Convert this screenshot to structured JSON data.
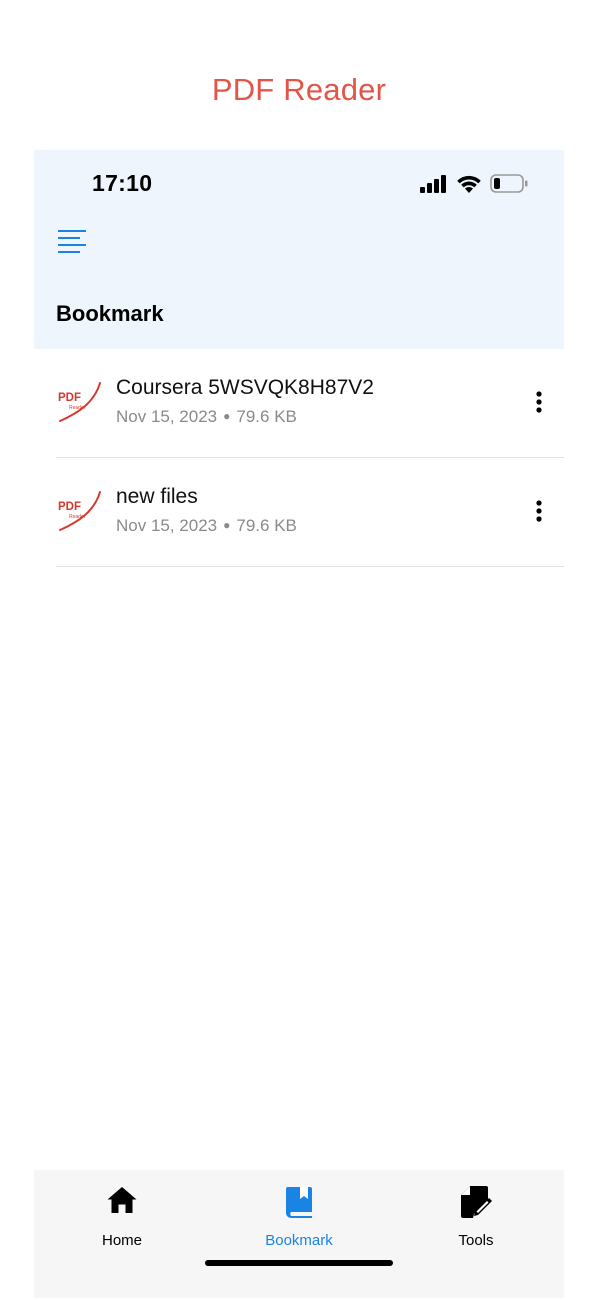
{
  "app_title": "PDF Reader",
  "status_bar": {
    "time": "17:10"
  },
  "header": {
    "title": "Bookmark"
  },
  "files": [
    {
      "name": "Coursera 5WSVQK8H87V2",
      "date": "Nov 15, 2023",
      "size": "79.6 KB"
    },
    {
      "name": "new files",
      "date": "Nov 15, 2023",
      "size": "79.6 KB"
    }
  ],
  "pdf_icon": {
    "brand": "PDF",
    "sub": "Reader"
  },
  "tabs": [
    {
      "label": "Home",
      "icon": "home-icon"
    },
    {
      "label": "Bookmark",
      "icon": "bookmark-icon",
      "active": true
    },
    {
      "label": "Tools",
      "icon": "edit-document-icon"
    }
  ],
  "colors": {
    "accent": "#1a84e5",
    "title_red": "#e2564a",
    "header_bg": "#eff5fd",
    "tabbar_bg": "#f6f6f7",
    "meta_gray": "#8a8a8e"
  }
}
